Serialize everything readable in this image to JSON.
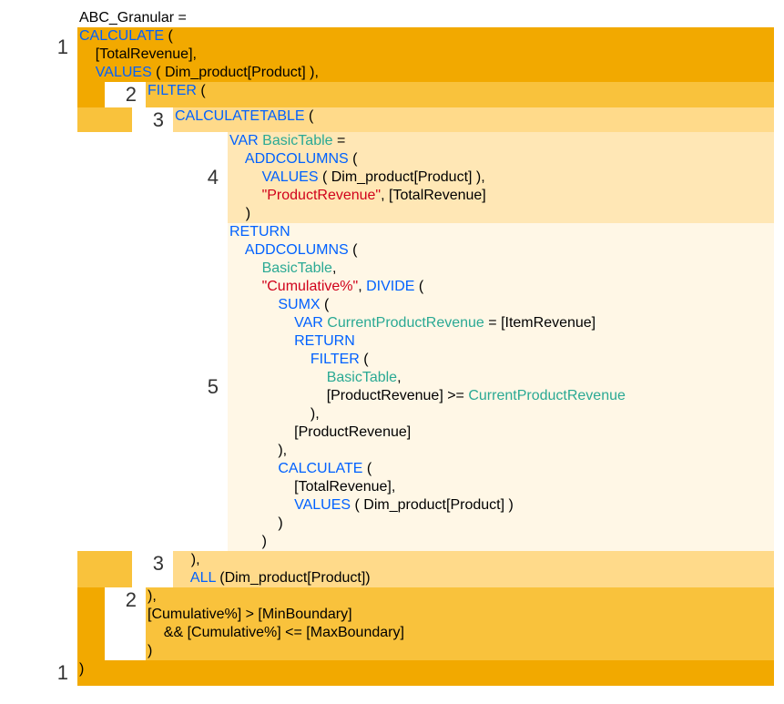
{
  "nesting_labels": {
    "n1": "1",
    "n2": "2",
    "n3": "3",
    "n4": "4",
    "n5": "5"
  },
  "code": {
    "l0": "ABC_Granular =",
    "l1a": "CALCULATE",
    "l1b": " (",
    "l2": "    [TotalRevenue],",
    "l3a": "    ",
    "l3b": "VALUES",
    "l3c": " ( ",
    "l3d": "Dim_product[Product]",
    "l3e": " ),",
    "l4a": "FILTER",
    "l4b": " (",
    "l5a": "CALCULATETABLE",
    "l5b": " (",
    "l6a": "VAR",
    "l6b": " BasicTable ",
    "l6c": "=",
    "l7a": "    ",
    "l7b": "ADDCOLUMNS",
    "l7c": " (",
    "l8a": "        ",
    "l8b": "VALUES",
    "l8c": " ( ",
    "l8d": "Dim_product[Product]",
    "l8e": " ),",
    "l9a": "        ",
    "l9b": "\"ProductRevenue\"",
    "l9c": ", [TotalRevenue]",
    "l10": "    )",
    "l11": "RETURN",
    "l12a": "    ",
    "l12b": "ADDCOLUMNS",
    "l12c": " (",
    "l13a": "        ",
    "l13b": "BasicTable",
    "l13c": ",",
    "l14a": "        ",
    "l14b": "\"Cumulative%\"",
    "l14c": ", ",
    "l14d": "DIVIDE",
    "l14e": " (",
    "l15a": "            ",
    "l15b": "SUMX",
    "l15c": " (",
    "l16a": "                ",
    "l16b": "VAR",
    "l16c": " CurrentProductRevenue ",
    "l16d": "= [ItemRevenue]",
    "l17a": "                ",
    "l17b": "RETURN",
    "l18a": "                    ",
    "l18b": "FILTER",
    "l18c": " (",
    "l19a": "                        ",
    "l19b": "BasicTable",
    "l19c": ",",
    "l20a": "                        ",
    "l20b": "[ProductRevenue] >= ",
    "l20c": "CurrentProductRevenue",
    "l21": "                    ),",
    "l22": "                [ProductRevenue]",
    "l23": "            ),",
    "l24a": "            ",
    "l24b": "CALCULATE",
    "l24c": " (",
    "l25": "                [TotalRevenue],",
    "l26a": "                ",
    "l26b": "VALUES",
    "l26c": " ( ",
    "l26d": "Dim_product[Product]",
    "l26e": " )",
    "l27": "            )",
    "l28": "        )",
    "l29": "    ),",
    "l30a": "    ",
    "l30b": "ALL",
    "l30c": " (",
    "l30d": "Dim_product[Product]",
    "l30e": ")",
    "l31": "),",
    "l32": "[Cumulative%] > [MinBoundary]",
    "l33": "    && [Cumulative%] <= [MaxBoundary]",
    "l34": ")",
    "l35": ")"
  }
}
